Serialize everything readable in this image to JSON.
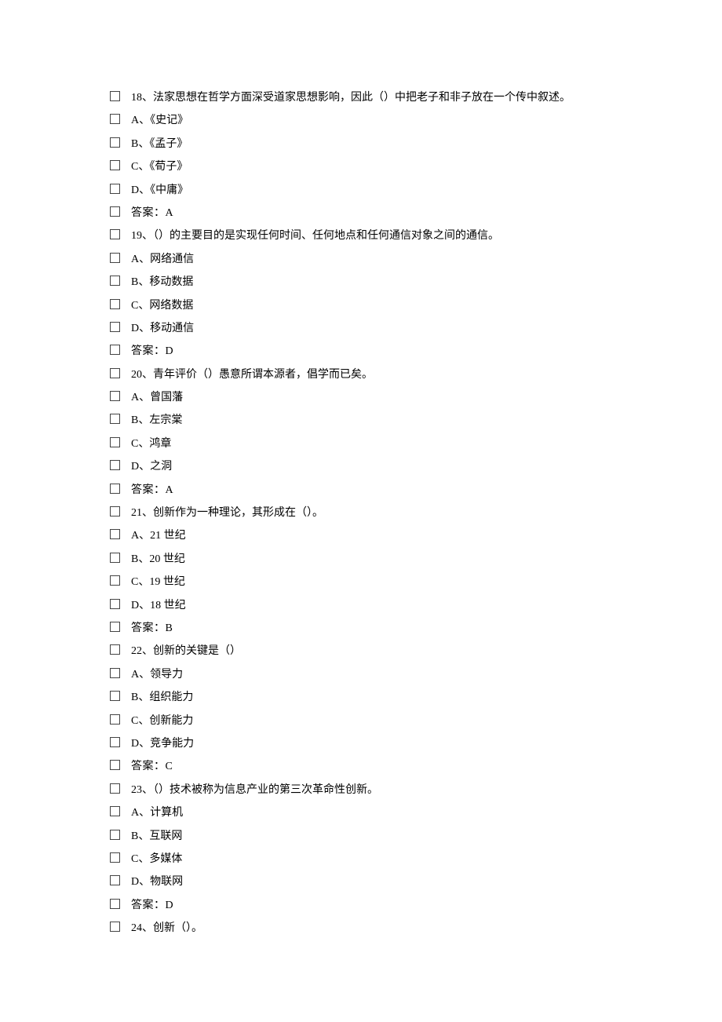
{
  "questions": [
    {
      "number": "18",
      "stem": "法家思想在哲学方面深受道家思想影响，因此（）中把老子和非子放在一个传中叙述。",
      "options": [
        {
          "letter": "A",
          "text": "《史记》"
        },
        {
          "letter": "B",
          "text": "《孟子》"
        },
        {
          "letter": "C",
          "text": "《荀子》"
        },
        {
          "letter": "D",
          "text": "《中庸》"
        }
      ],
      "answerLabel": "答案：",
      "answer": "A"
    },
    {
      "number": "19",
      "stem": "（）的主要目的是实现任何时间、任何地点和任何通信对象之间的通信。",
      "options": [
        {
          "letter": "A",
          "text": "网络通信"
        },
        {
          "letter": "B",
          "text": "移动数据"
        },
        {
          "letter": "C",
          "text": "网络数据"
        },
        {
          "letter": "D",
          "text": "移动通信"
        }
      ],
      "answerLabel": "答案：",
      "answer": "D"
    },
    {
      "number": "20",
      "stem": "青年评价（）愚意所谓本源者，倡学而已矣。",
      "options": [
        {
          "letter": "A",
          "text": "曾国藩"
        },
        {
          "letter": "B",
          "text": "左宗棠"
        },
        {
          "letter": "C",
          "text": "鸿章"
        },
        {
          "letter": "D",
          "text": "之洞"
        }
      ],
      "answerLabel": "答案：",
      "answer": "A"
    },
    {
      "number": "21",
      "stem": "创新作为一种理论，其形成在（）。",
      "options": [
        {
          "letter": "A",
          "text": "21 世纪"
        },
        {
          "letter": "B",
          "text": "20 世纪"
        },
        {
          "letter": "C",
          "text": "19 世纪"
        },
        {
          "letter": "D",
          "text": "18 世纪"
        }
      ],
      "answerLabel": "答案：",
      "answer": "B"
    },
    {
      "number": "22",
      "stem": "创新的关键是（）",
      "options": [
        {
          "letter": "A",
          "text": "领导力"
        },
        {
          "letter": "B",
          "text": "组织能力"
        },
        {
          "letter": "C",
          "text": "创新能力"
        },
        {
          "letter": "D",
          "text": "竞争能力"
        }
      ],
      "answerLabel": "答案：",
      "answer": "C"
    },
    {
      "number": "23",
      "stem": "（）技术被称为信息产业的第三次革命性创新。",
      "options": [
        {
          "letter": "A",
          "text": "计算机"
        },
        {
          "letter": "B",
          "text": "互联网"
        },
        {
          "letter": "C",
          "text": "多媒体"
        },
        {
          "letter": "D",
          "text": "物联网"
        }
      ],
      "answerLabel": "答案：",
      "answer": "D"
    },
    {
      "number": "24",
      "stem": "创新（）。",
      "options": [],
      "answerLabel": "",
      "answer": ""
    }
  ]
}
